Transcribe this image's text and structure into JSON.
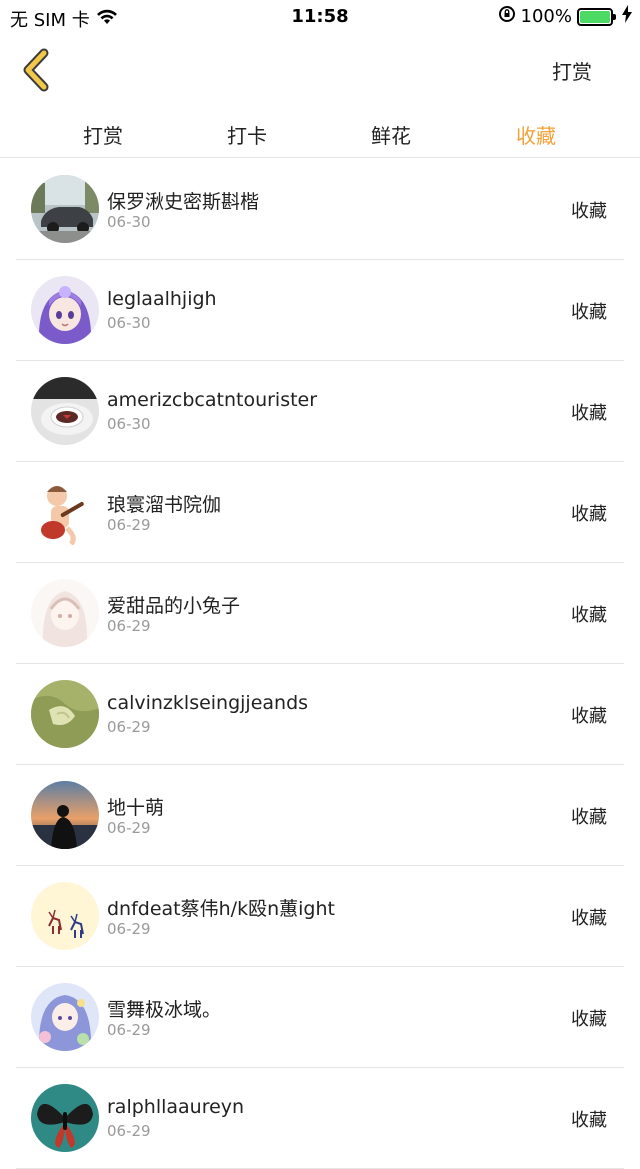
{
  "status_bar": {
    "carrier": "无 SIM 卡",
    "time": "11:58",
    "battery_percent": "100%",
    "battery_color": "#4cd964"
  },
  "nav": {
    "back_icon": "chevron-left-icon",
    "back_color": "#f2c84b",
    "right_action": "打赏"
  },
  "tabs": [
    {
      "label": "打赏",
      "active": false
    },
    {
      "label": "打卡",
      "active": false
    },
    {
      "label": "鲜花",
      "active": false
    },
    {
      "label": "收藏",
      "active": true
    }
  ],
  "colors": {
    "accent": "#f2a33a",
    "divider": "#e6e6e6",
    "date_text": "#9a9a9a"
  },
  "items": [
    {
      "name": "保罗湫史密斯斟楷",
      "date": "06-30",
      "action": "收藏",
      "avatar": "car-photo"
    },
    {
      "name": "leglaalhjigh",
      "date": "06-30",
      "action": "收藏",
      "avatar": "anime-girl-purple"
    },
    {
      "name": "amerizcbcatntourister",
      "date": "06-30",
      "action": "收藏",
      "avatar": "coffee-cup"
    },
    {
      "name": "琅寰溜书院伽",
      "date": "06-29",
      "action": "收藏",
      "avatar": "cartoon-guitar"
    },
    {
      "name": "爱甜品的小兔子",
      "date": "06-29",
      "action": "收藏",
      "avatar": "anime-girl-sketch"
    },
    {
      "name": "calvinzklseingjjeands",
      "date": "06-29",
      "action": "收藏",
      "avatar": "green-fabric"
    },
    {
      "name": "地十萌",
      "date": "06-29",
      "action": "收藏",
      "avatar": "sunset-silhouette"
    },
    {
      "name": "dnfdeat蔡伟h/k殴n蕙ight",
      "date": "06-29",
      "action": "收藏",
      "avatar": "deer-illustration"
    },
    {
      "name": "雪舞极冰域。",
      "date": "06-29",
      "action": "收藏",
      "avatar": "anime-girl-flowers"
    },
    {
      "name": "ralphllaaureyn",
      "date": "06-29",
      "action": "收藏",
      "avatar": "butterfly"
    }
  ]
}
